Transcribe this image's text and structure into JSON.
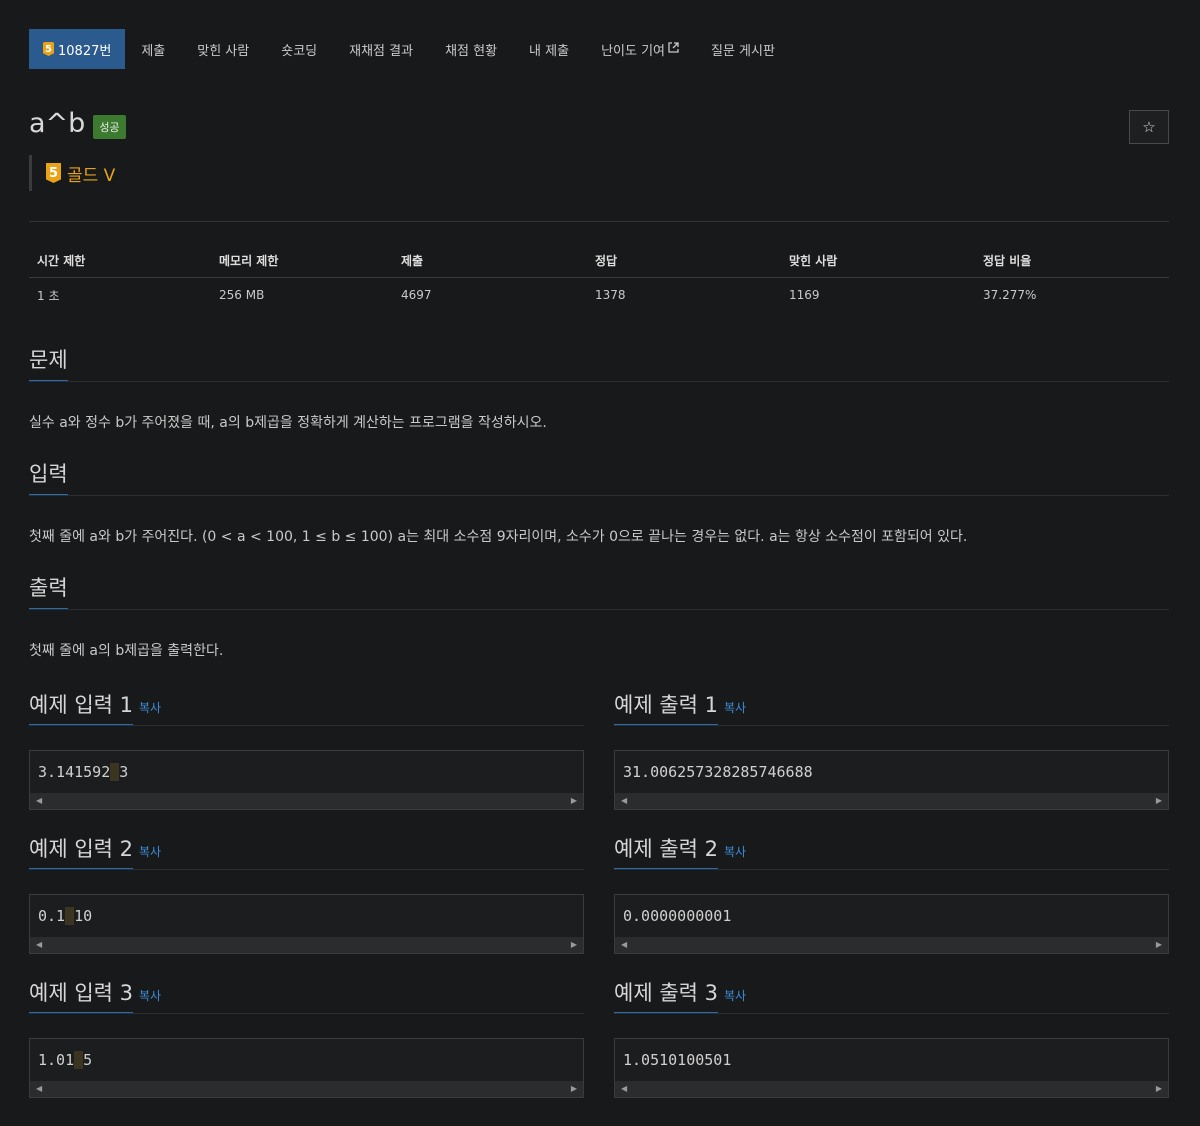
{
  "nav": {
    "problem_tier": "5",
    "problem_number": "10827번",
    "items": [
      "제출",
      "맞힌 사람",
      "숏코딩",
      "재채점 결과",
      "채점 현황",
      "내 제출",
      "난이도 기여",
      "질문 게시판"
    ]
  },
  "problem": {
    "title": "a^b",
    "status": "성공",
    "tier_number": "5",
    "tier_name": "골드 V",
    "star": "☆"
  },
  "info": {
    "headers": [
      "시간 제한",
      "메모리 제한",
      "제출",
      "정답",
      "맞힌 사람",
      "정답 비율"
    ],
    "values": [
      "1 초",
      "256 MB",
      "4697",
      "1378",
      "1169",
      "37.277%"
    ]
  },
  "sections": {
    "problem": {
      "title": "문제",
      "text": "실수 a와 정수 b가 주어졌을 때, a의 b제곱을 정확하게 계산하는 프로그램을 작성하시오."
    },
    "input": {
      "title": "입력",
      "text": "첫째 줄에 a와 b가 주어진다. (0 < a < 100, 1 ≤ b ≤ 100) a는 최대 소수점 9자리이며, 소수가 0으로 끝나는 경우는 없다. a는 항상 소수점이 포함되어 있다."
    },
    "output": {
      "title": "출력",
      "text": "첫째 줄에 a의 b제곱을 출력한다."
    }
  },
  "copy_label": "복사",
  "samples": [
    {
      "in_title": "예제 입력 1",
      "in_a": "3.141592",
      "in_b": "3",
      "out_title": "예제 출력 1",
      "out": "31.006257328285746688"
    },
    {
      "in_title": "예제 입력 2",
      "in_a": "0.1",
      "in_b": "10",
      "out_title": "예제 출력 2",
      "out": "0.0000000001"
    },
    {
      "in_title": "예제 입력 3",
      "in_a": "1.01",
      "in_b": "5",
      "out_title": "예제 출력 3",
      "out": "1.0510100501"
    }
  ]
}
